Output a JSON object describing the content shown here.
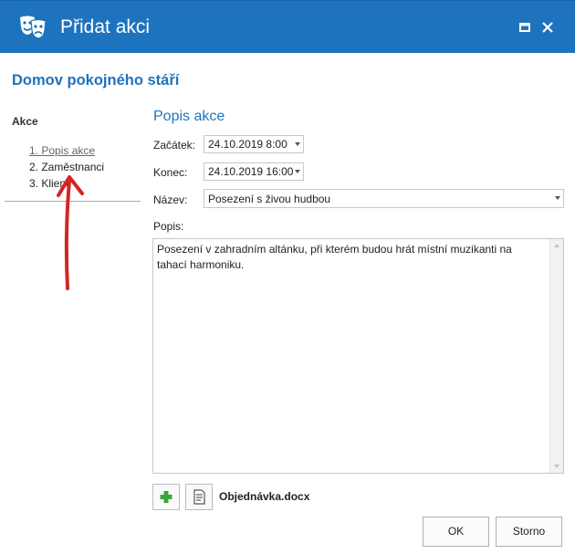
{
  "window": {
    "title": "Přidat akci",
    "app_icon": "theater-masks-icon",
    "title_bar_color": "#1e73be",
    "controls": [
      "maximize-icon",
      "close-icon"
    ]
  },
  "organization": "Domov pokojného stáří",
  "nav": {
    "heading": "Akce",
    "items": [
      {
        "label": "1. Popis akce",
        "active": true
      },
      {
        "label": "2. Zaměstnanci",
        "active": false
      },
      {
        "label": "3. Klienti",
        "active": false
      }
    ]
  },
  "annotation": {
    "type": "red-arrow-pointing-up",
    "color": "#d42424"
  },
  "form": {
    "title": "Popis akce",
    "start_label": "Začátek:",
    "start_value": "24.10.2019 8:00",
    "end_label": "Konec:",
    "end_value": "24.10.2019 16:00",
    "name_label": "Název:",
    "name_value": "Posezení s živou hudbou",
    "description_label": "Popis:",
    "description_value": "Posezení v zahradním altánku, při kterém budou hrát místní muzikanti na tahací harmoniku."
  },
  "attachments": {
    "add_icon": "plus-icon",
    "document_icon": "document-icon",
    "file_name": "Objednávka.docx"
  },
  "buttons": {
    "ok": "OK",
    "cancel": "Storno"
  },
  "colors": {
    "accent": "#1e73be",
    "add_green": "#3aa63a"
  }
}
